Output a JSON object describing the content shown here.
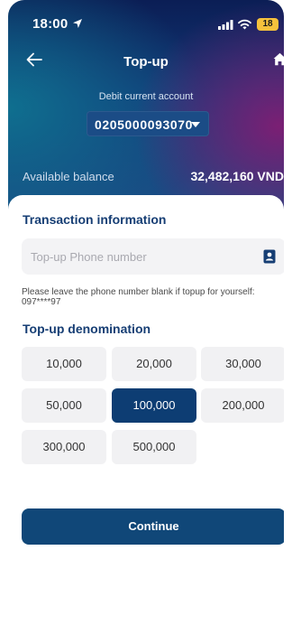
{
  "status_bar": {
    "time": "18:00",
    "battery": "18",
    "icons": [
      "location-arrow-icon",
      "signal-icon",
      "wifi-icon",
      "battery-icon"
    ]
  },
  "nav": {
    "title": "Top-up",
    "icons": [
      "back-arrow-icon",
      "home-icon"
    ]
  },
  "account": {
    "label": "Debit current account",
    "number": "0205000093070"
  },
  "balance": {
    "label": "Available balance",
    "value": "32,482,160 VND"
  },
  "transaction": {
    "title": "Transaction information",
    "phone_placeholder": "Top-up Phone number",
    "phone_value": "",
    "hint": "Please leave the phone number blank if topup for yourself: 097****97"
  },
  "denomination": {
    "title": "Top-up denomination",
    "options": [
      "10,000",
      "20,000",
      "30,000",
      "50,000",
      "100,000",
      "200,000",
      "300,000",
      "500,000"
    ],
    "selected": "100,000"
  },
  "continue_label": "Continue",
  "colors": {
    "primary": "#0d3d73",
    "selected": "#0d3d73",
    "button": "#104778",
    "title": "#163e74",
    "battery": "#f6c23c"
  }
}
